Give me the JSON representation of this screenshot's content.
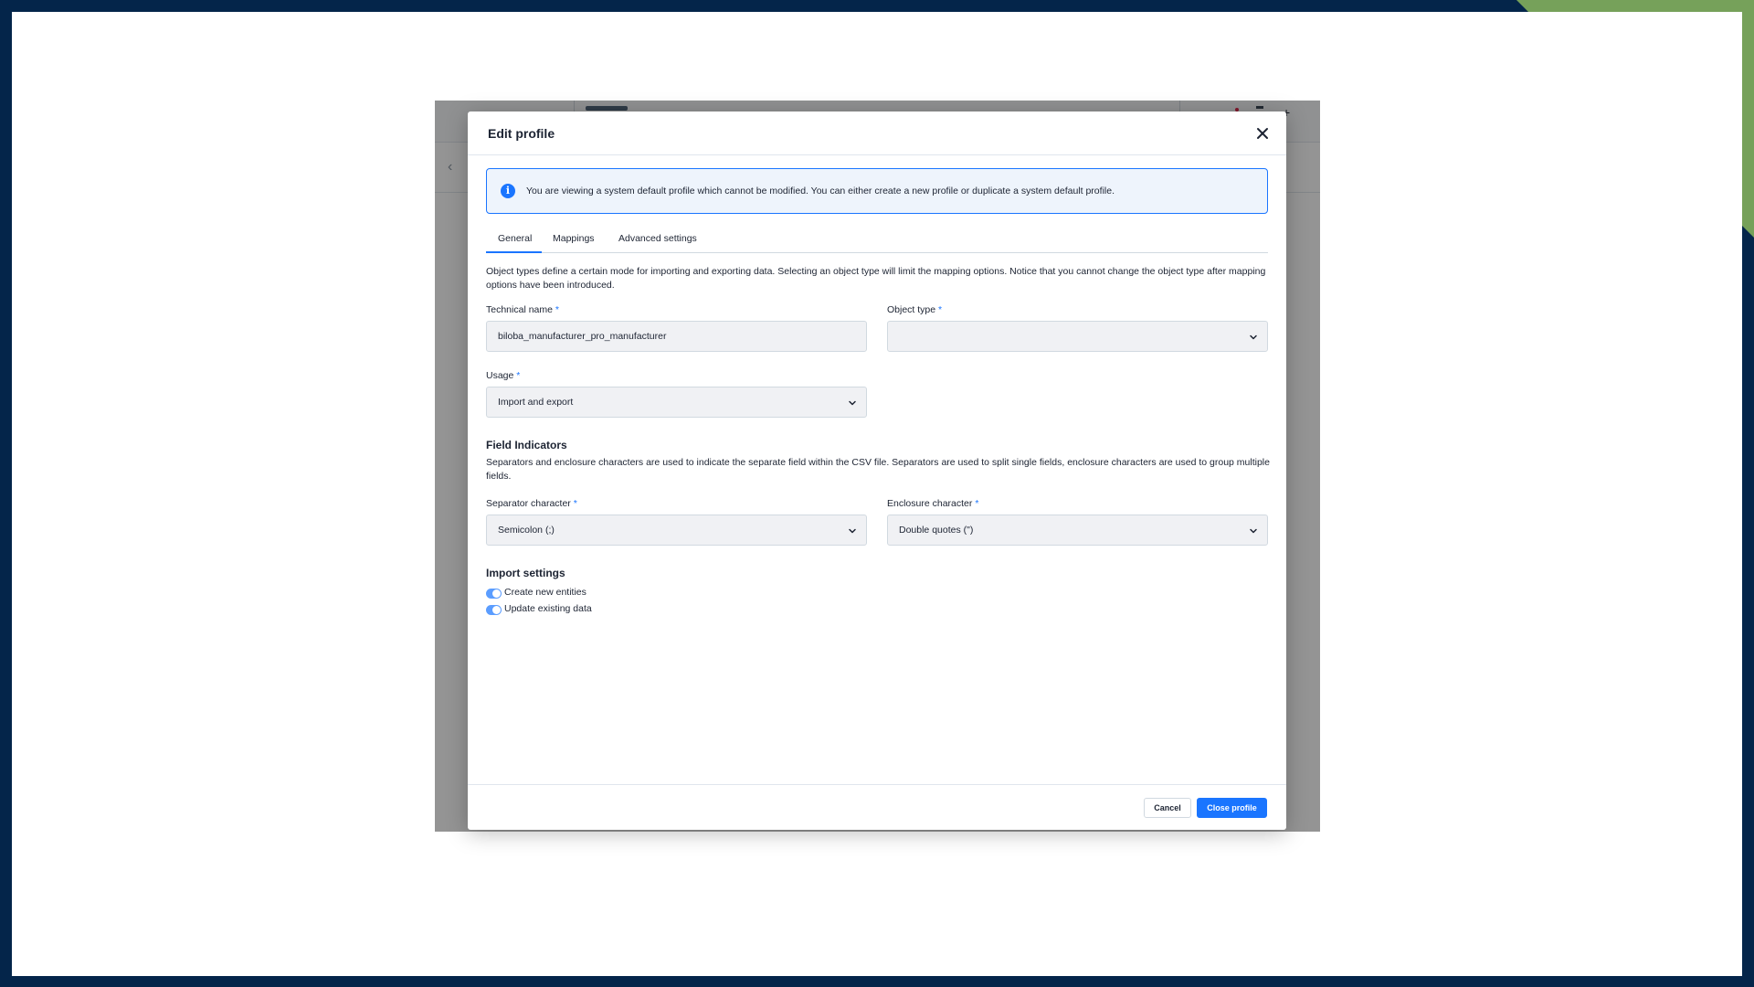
{
  "modal": {
    "title": "Edit profile",
    "alert_text": "You are viewing a system default profile which cannot be modified. You can either create a new profile or duplicate a system default profile.",
    "tabs": [
      {
        "label": "General",
        "active": true
      },
      {
        "label": "Mappings",
        "active": false
      },
      {
        "label": "Advanced settings",
        "active": false
      }
    ],
    "description": "Object types define a certain mode for importing and exporting data. Selecting an object type will limit the mapping options. Notice that you cannot change the object type after mapping options have been introduced.",
    "technical_name": {
      "label": "Technical name",
      "required_mark": "*",
      "value": "biloba_manufacturer_pro_manufacturer"
    },
    "object_type": {
      "label": "Object type",
      "required_mark": "*",
      "value": ""
    },
    "usage": {
      "label": "Usage",
      "required_mark": "*",
      "value": "Import and export"
    },
    "field_indicators": {
      "title": "Field Indicators",
      "description": "Separators and enclosure characters are used to indicate the separate field within the CSV file. Separators are used to split single fields, enclosure characters are used to group multiple fields.",
      "separator": {
        "label": "Separator character",
        "required_mark": "*",
        "value": "Semicolon (;)"
      },
      "enclosure": {
        "label": "Enclosure character",
        "required_mark": "*",
        "value": "Double quotes (\")"
      }
    },
    "import_settings": {
      "title": "Import settings",
      "toggles": [
        {
          "label": "Create new entities",
          "checked": true
        },
        {
          "label": "Update existing data",
          "checked": true
        }
      ]
    },
    "footer": {
      "cancel_label": "Cancel",
      "close_label": "Close profile"
    }
  },
  "colors": {
    "accent": "#1a75ff",
    "frame": "#04254a",
    "frame_corner": "#76a15a"
  },
  "icons": {
    "close": "close-icon",
    "info": "info-icon",
    "chevron": "chevron-down-icon"
  }
}
